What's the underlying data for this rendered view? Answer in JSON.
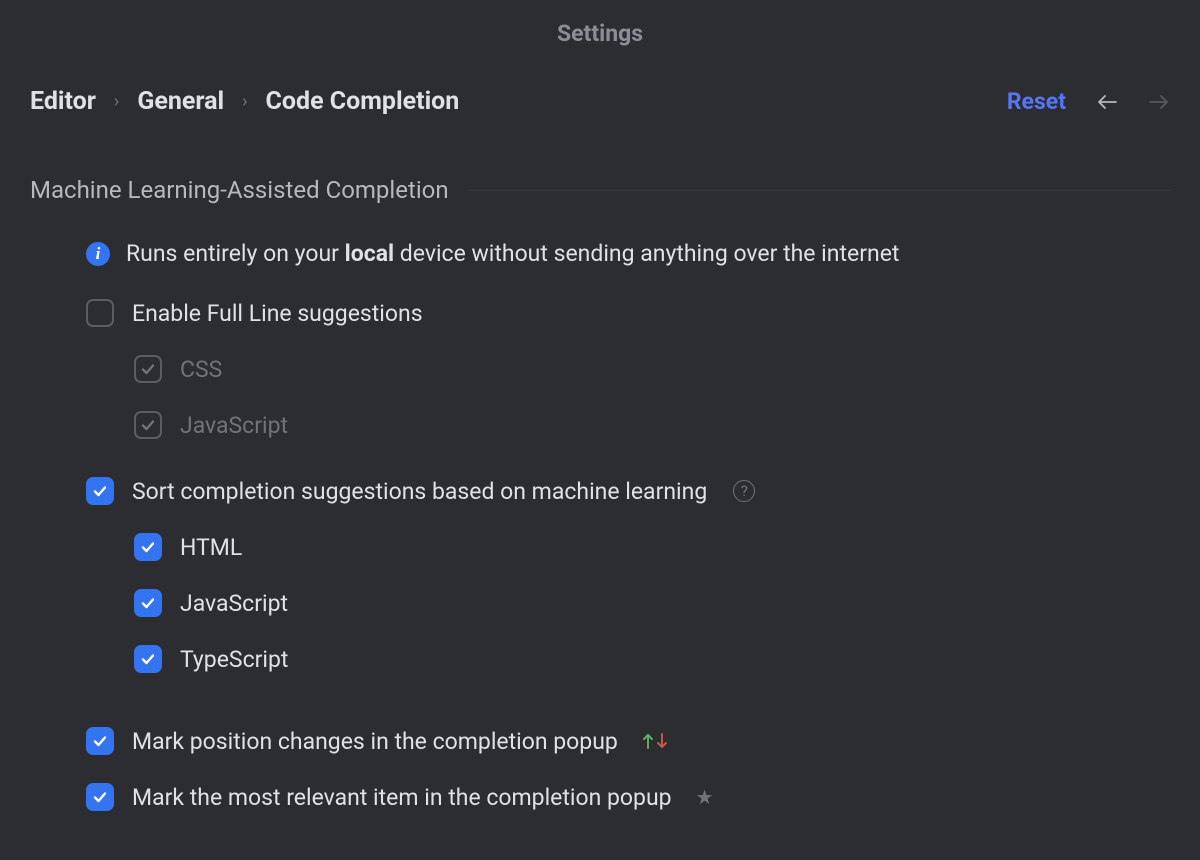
{
  "header": {
    "title": "Settings"
  },
  "breadcrumb": {
    "items": [
      "Editor",
      "General",
      "Code Completion"
    ]
  },
  "actions": {
    "reset": "Reset"
  },
  "section": {
    "title": "Machine Learning-Assisted Completion",
    "info_pre": "Runs entirely on your ",
    "info_bold": "local",
    "info_post": " device without sending anything over the internet"
  },
  "options": {
    "enable_full_line": {
      "label": "Enable Full Line suggestions",
      "checked": false,
      "children": [
        {
          "label": "CSS",
          "checked": true,
          "disabled": true
        },
        {
          "label": "JavaScript",
          "checked": true,
          "disabled": true
        }
      ]
    },
    "sort_ml": {
      "label": "Sort completion suggestions based on machine learning",
      "checked": true,
      "children": [
        {
          "label": "HTML",
          "checked": true
        },
        {
          "label": "JavaScript",
          "checked": true
        },
        {
          "label": "TypeScript",
          "checked": true
        }
      ]
    },
    "mark_position": {
      "label": "Mark position changes in the completion popup",
      "checked": true
    },
    "mark_relevant": {
      "label": "Mark the most relevant item in the completion popup",
      "checked": true
    }
  },
  "colors": {
    "accent": "#3574f0",
    "link": "#5776f6",
    "up_arrow": "#5fad65",
    "down_arrow": "#c75450"
  }
}
